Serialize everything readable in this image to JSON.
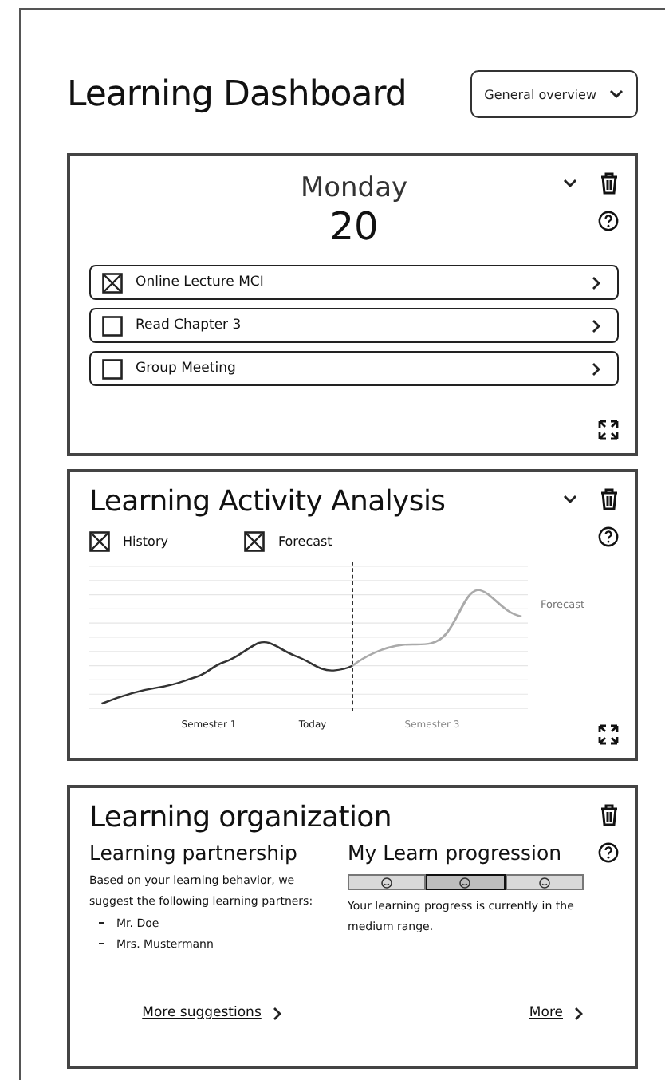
{
  "title": "Learning Dashboard",
  "view_select": {
    "value": "General overview"
  },
  "day_card": {
    "weekday": "Monday",
    "date": "20",
    "tasks": [
      {
        "label": "Online Lecture MCI",
        "checked": true
      },
      {
        "label": "Read Chapter 3",
        "checked": false
      },
      {
        "label": "Group Meeting",
        "checked": false
      }
    ]
  },
  "activity_card": {
    "title": "Learning Activity Analysis",
    "legend": [
      {
        "label": "History",
        "checked": true
      },
      {
        "label": "Forecast",
        "checked": true
      }
    ],
    "forecast_label": "Forecast",
    "x_labels": [
      {
        "label": "Semester 1",
        "muted": false
      },
      {
        "label": "Today",
        "muted": false
      },
      {
        "label": "Semester 3",
        "muted": true
      }
    ]
  },
  "organization_card": {
    "title": "Learning organization",
    "partnership": {
      "title": "Learning partnership",
      "text": "Based on your learning behavior, we suggest the following learning partners:",
      "partners": [
        "Mr. Doe",
        "Mrs. Mustermann"
      ],
      "link": "More suggestions"
    },
    "progression": {
      "title": "My Learn progression",
      "segments": [
        {
          "selected": false
        },
        {
          "selected": true
        },
        {
          "selected": false
        }
      ],
      "text": "Your learning progress is currently in the medium range.",
      "link": "More"
    }
  }
}
